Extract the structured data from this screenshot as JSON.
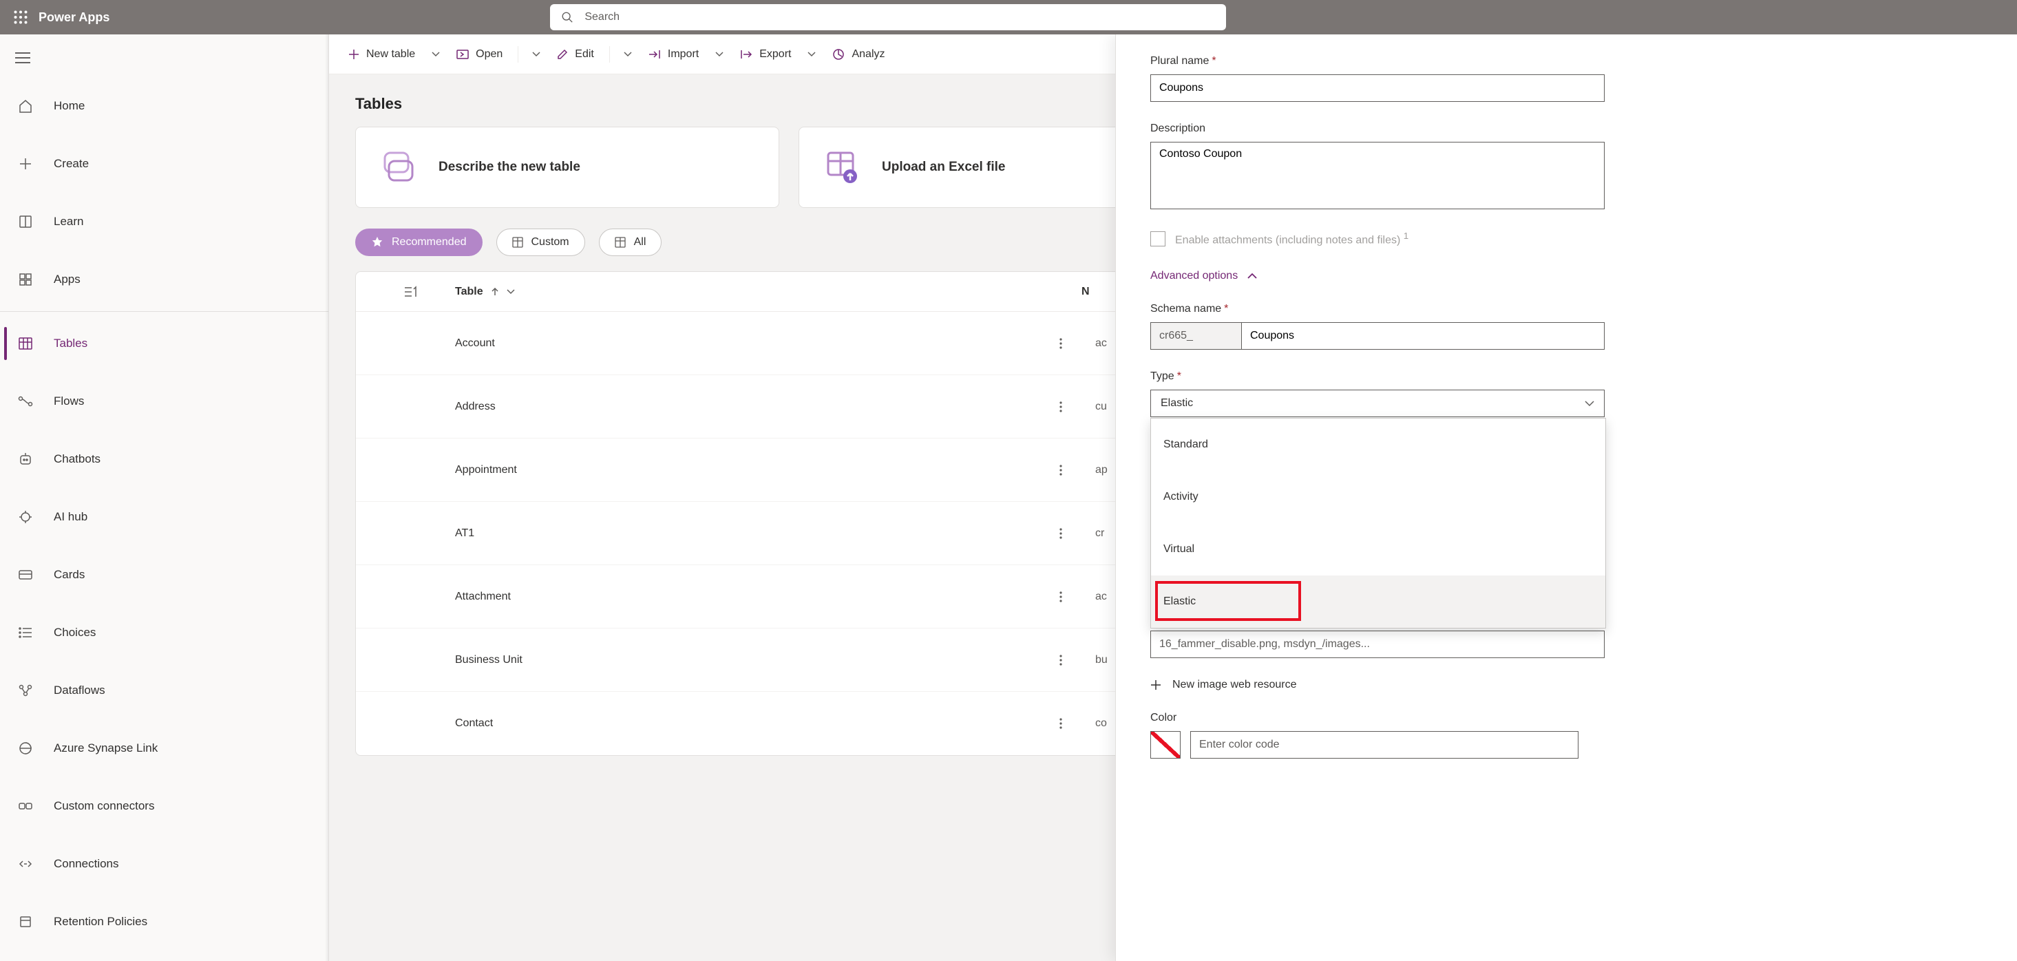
{
  "header": {
    "brand": "Power Apps",
    "search_placeholder": "Search"
  },
  "nav": {
    "items": [
      {
        "label": "Home",
        "icon": "home"
      },
      {
        "label": "Create",
        "icon": "plus"
      },
      {
        "label": "Learn",
        "icon": "book"
      },
      {
        "label": "Apps",
        "icon": "grid"
      },
      {
        "label": "Tables",
        "icon": "table",
        "selected": true
      },
      {
        "label": "Flows",
        "icon": "flow"
      },
      {
        "label": "Chatbots",
        "icon": "bot"
      },
      {
        "label": "AI hub",
        "icon": "ai"
      },
      {
        "label": "Cards",
        "icon": "cards"
      },
      {
        "label": "Choices",
        "icon": "choices"
      },
      {
        "label": "Dataflows",
        "icon": "dataflow"
      },
      {
        "label": "Azure Synapse Link",
        "icon": "synapse"
      },
      {
        "label": "Custom connectors",
        "icon": "connector"
      },
      {
        "label": "Connections",
        "icon": "connection"
      },
      {
        "label": "Retention Policies",
        "icon": "retention"
      }
    ]
  },
  "commands": {
    "new_table": "New table",
    "open": "Open",
    "edit": "Edit",
    "import": "Import",
    "export": "Export",
    "analyze": "Analyz"
  },
  "page": {
    "title": "Tables",
    "card_describe": "Describe the new table",
    "card_upload": "Upload an Excel file"
  },
  "filters": {
    "recommended": "Recommended",
    "custom": "Custom",
    "all": "All"
  },
  "table": {
    "col_table": "Table",
    "col_n": "N",
    "rows": [
      {
        "name": "Account",
        "type": "ac"
      },
      {
        "name": "Address",
        "type": "cu"
      },
      {
        "name": "Appointment",
        "type": "ap"
      },
      {
        "name": "AT1",
        "type": "cr"
      },
      {
        "name": "Attachment",
        "type": "ac"
      },
      {
        "name": "Business Unit",
        "type": "bu"
      },
      {
        "name": "Contact",
        "type": "co"
      }
    ]
  },
  "panel": {
    "plural_label": "Plural name",
    "plural_value": "Coupons",
    "desc_label": "Description",
    "desc_value": "Contoso Coupon",
    "attachments_label": "Enable attachments (including notes and files)",
    "attachments_sup": "1",
    "advanced": "Advanced options",
    "schema_label": "Schema name",
    "schema_prefix": "cr665_",
    "schema_value": "Coupons",
    "type_label": "Type",
    "type_value": "Elastic",
    "type_options": [
      "Standard",
      "Activity",
      "Virtual",
      "Elastic"
    ],
    "cutoff_text": "16_fammer_disable.png, msdyn_/images...",
    "new_image": "New image web resource",
    "color_label": "Color",
    "color_placeholder": "Enter color code"
  }
}
